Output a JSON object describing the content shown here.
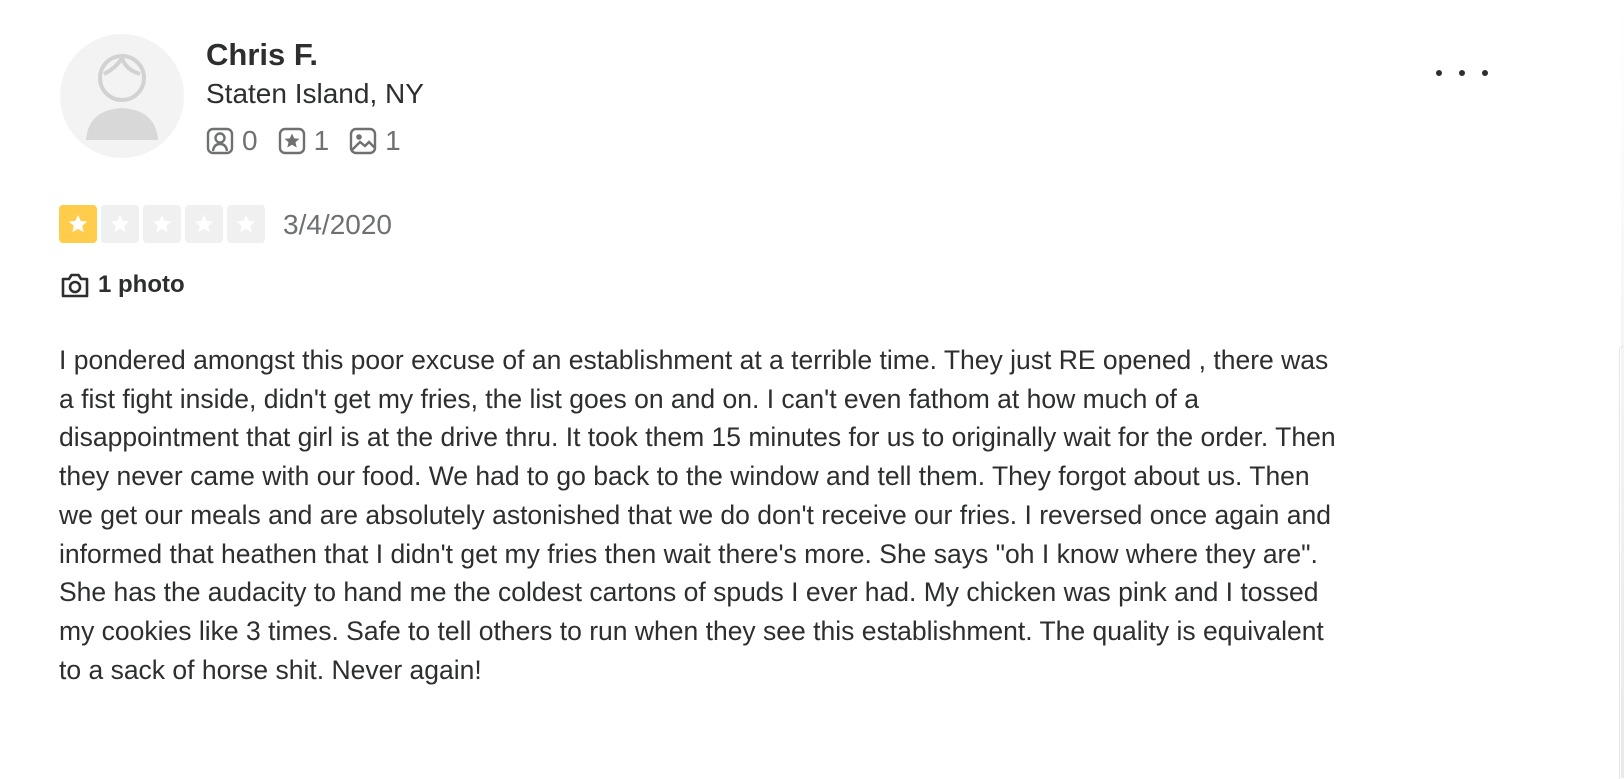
{
  "user": {
    "name": "Chris F.",
    "location": "Staten Island, NY",
    "stats": [
      {
        "icon": "friends-icon",
        "value": "0"
      },
      {
        "icon": "reviews-icon",
        "value": "1"
      },
      {
        "icon": "photos-icon",
        "value": "1"
      }
    ]
  },
  "review": {
    "rating": 1,
    "max_rating": 5,
    "date": "3/4/2020",
    "photo_count_label": "1 photo",
    "text": "I pondered amongst this poor excuse of an establishment at a terrible time. They just RE opened , there was a fist fight inside, didn't get my fries, the list goes on and on. I can't even fathom at how much of a disappointment that girl is at the drive thru. It took them 15 minutes for us to originally wait for the order. Then they never came with our food. We had to go back to the window and tell them. They forgot about us. Then we get our meals and are absolutely astonished that we do don't receive our fries. I reversed once again and informed that heathen that I didn't get my fries then wait there's more. She says \"oh I know where they are\". She has the audacity to hand me the coldest cartons of spuds I ever had. My chicken was pink and I tossed my cookies like 3 times. Safe to tell others to run when they see this establishment. The quality is equivalent to a sack of horse shit. Never again!"
  },
  "colors": {
    "star_filled": "#ffcc4b",
    "star_empty": "#f0f0f0",
    "text": "#2d2e2f",
    "muted": "#6e7072"
  }
}
